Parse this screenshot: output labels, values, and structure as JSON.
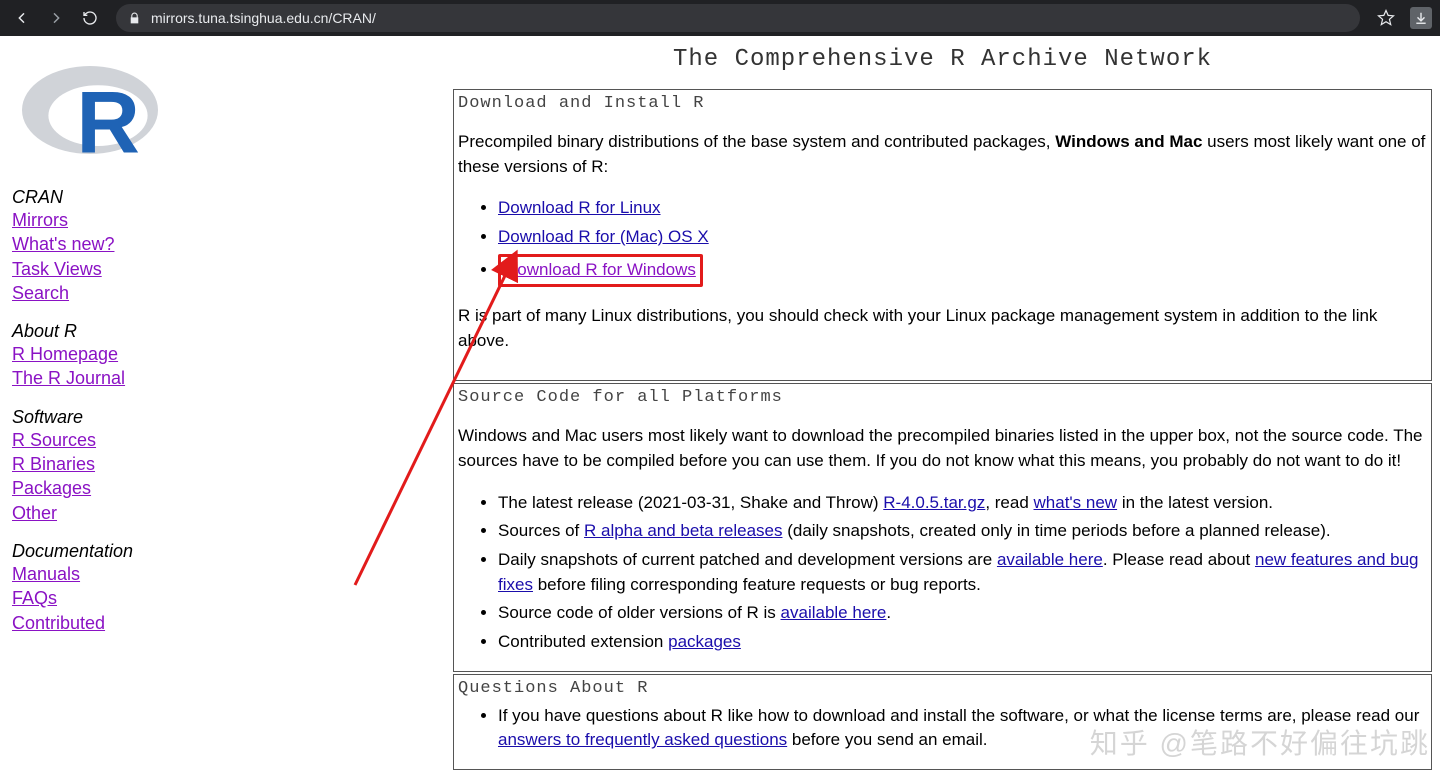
{
  "browser": {
    "url": "mirrors.tuna.tsinghua.edu.cn/CRAN/"
  },
  "sidebar": {
    "groups": [
      {
        "title": "CRAN",
        "links": [
          {
            "label": "Mirrors"
          },
          {
            "label": "What's new?"
          },
          {
            "label": "Task Views"
          },
          {
            "label": "Search"
          }
        ]
      },
      {
        "title": "About R",
        "links": [
          {
            "label": "R Homepage"
          },
          {
            "label": "The R Journal"
          }
        ]
      },
      {
        "title": "Software",
        "links": [
          {
            "label": "R Sources"
          },
          {
            "label": "R Binaries"
          },
          {
            "label": "Packages"
          },
          {
            "label": "Other"
          }
        ]
      },
      {
        "title": "Documentation",
        "links": [
          {
            "label": "Manuals"
          },
          {
            "label": "FAQs"
          },
          {
            "label": "Contributed"
          }
        ]
      }
    ]
  },
  "page_title": "The Comprehensive R Archive Network",
  "box1": {
    "title": "Download and Install R",
    "intro_a": "Precompiled binary distributions of the base system and contributed packages, ",
    "intro_bold": "Windows and Mac",
    "intro_b": " users most likely want one of these versions of R:",
    "dl_linux": "Download R for Linux",
    "dl_mac": "Download R for (Mac) OS X",
    "dl_win": "Download R for Windows",
    "after": "R is part of many Linux distributions, you should check with your Linux package management system in addition to the link above."
  },
  "box2": {
    "title": "Source Code for all Platforms",
    "intro": "Windows and Mac users most likely want to download the precompiled binaries listed in the upper box, not the source code. The sources have to be compiled before you can use them. If you do not know what this means, you probably do not want to do it!",
    "li1_a": "The latest release (2021-03-31, Shake and Throw) ",
    "li1_link1": "R-4.0.5.tar.gz",
    "li1_b": ", read ",
    "li1_link2": "what's new",
    "li1_c": " in the latest version.",
    "li2_a": "Sources of ",
    "li2_link": "R alpha and beta releases",
    "li2_b": " (daily snapshots, created only in time periods before a planned release).",
    "li3_a": "Daily snapshots of current patched and development versions are ",
    "li3_link1": "available here",
    "li3_b": ". Please read about ",
    "li3_link2": "new features and bug fixes",
    "li3_c": " before filing corresponding feature requests or bug reports.",
    "li4_a": "Source code of older versions of R is ",
    "li4_link": "available here",
    "li4_b": ".",
    "li5_a": "Contributed extension ",
    "li5_link": "packages"
  },
  "box3": {
    "title": "Questions About R",
    "li1_a": "If you have questions about R like how to download and install the software, or what the license terms are, please read our ",
    "li1_link": "answers to frequently asked questions",
    "li1_b": " before you send an email."
  },
  "watermark": "知乎 @笔路不好偏往坑跳"
}
